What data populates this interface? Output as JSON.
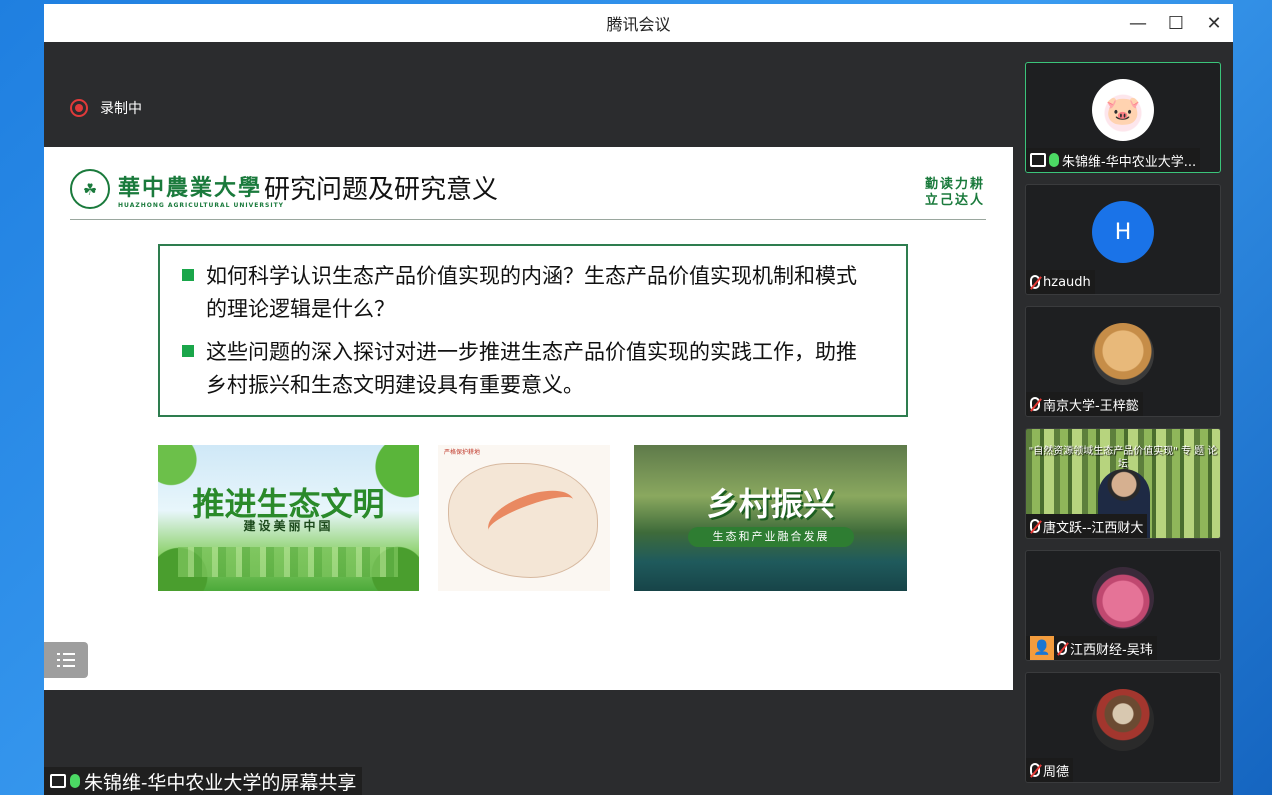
{
  "window": {
    "title": "腾讯会议",
    "controls": {
      "minimize": "—",
      "maximize": "☐",
      "close": "✕"
    }
  },
  "recording": {
    "label": "录制中"
  },
  "slide": {
    "university_cn": "華中農業大學",
    "university_en": "HUAZHONG AGRICULTURAL UNIVERSITY",
    "title": "研究问题及研究意义",
    "motto_line1": "勤读力耕",
    "motto_line2": "立己达人",
    "bullets": [
      "如何科学认识生态产品价值实现的内涵？生态产品价值实现机制和模式的理论逻辑是什么？",
      "这些问题的深入探讨对进一步推进生态产品价值实现的实践工作，助推乡村振兴和生态文明建设具有重要意义。"
    ],
    "image1_title": "推进生态文明",
    "image1_subtitle": "建设美丽中国",
    "image2_caption": "严格保护耕地",
    "image3_title": "乡村振兴",
    "image3_subtitle": "生态和产业融合发展"
  },
  "share_label": "朱锦维-华中农业大学的屏幕共享",
  "participants": [
    {
      "name": "朱锦维-华中农业大学...",
      "avatar": "🐷",
      "mic": "on",
      "sharing": true
    },
    {
      "name": "hzaudh",
      "avatar": "H",
      "mic": "off"
    },
    {
      "name": "南京大学-王梓懿",
      "avatar": "cat",
      "mic": "off"
    },
    {
      "name": "唐文跃--江西财大",
      "video_title": "\"自然资源领域生态产品价值实现\" 专 题 论 坛",
      "mic": "off"
    },
    {
      "name": "江西财经-吴玮",
      "avatar": "bear",
      "mic": "off"
    },
    {
      "name": "周德",
      "avatar": "speaker",
      "mic": "off"
    }
  ],
  "colors": {
    "accent_green": "#1a7a3c",
    "active_border": "#3bc47a",
    "record_red": "#e03a3a"
  }
}
